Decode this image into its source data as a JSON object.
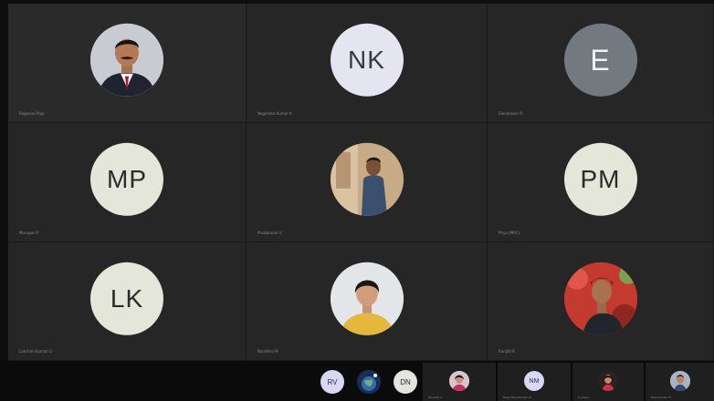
{
  "colors": {
    "tile_bg": "#262626",
    "tile_bg_alt": "#2a2a2a",
    "bottom_bar": "#0b0b0b",
    "initials_avatar_light": "#e4e6da",
    "initials_avatar_lilac": "#e5e5f2",
    "initials_avatar_grey": "#727a7f",
    "mini_avatar": "#d8d8f3"
  },
  "tiles": [
    {
      "name": "Ragavan Raju",
      "initials": "",
      "avatar": "photo-man-suit"
    },
    {
      "name": "Nagendra Kumar K",
      "initials": "NK",
      "avatar": "initials"
    },
    {
      "name": "Elavarasan R",
      "initials": "E",
      "avatar": "initials"
    },
    {
      "name": "Murugan P",
      "initials": "MP",
      "avatar": "initials"
    },
    {
      "name": "Prabakaran V",
      "initials": "",
      "avatar": "photo-man-outdoor"
    },
    {
      "name": "Priya (MPC)",
      "initials": "PM",
      "avatar": "initials"
    },
    {
      "name": "Lakshmi Kumari S",
      "initials": "LK",
      "avatar": "initials"
    },
    {
      "name": "Nandhini M",
      "initials": "",
      "avatar": "photo-woman"
    },
    {
      "name": "Ranjith K",
      "initials": "",
      "avatar": "photo-man-red"
    }
  ],
  "mini_avatars": [
    {
      "initials": "RV",
      "avatar": "initials"
    },
    {
      "initials": "",
      "avatar": "photo-earth"
    },
    {
      "initials": "DN",
      "avatar": "initials"
    }
  ],
  "strip": [
    {
      "name": "Deepika S",
      "initials": "",
      "avatar": "photo-woman-pink"
    },
    {
      "name": "Naga Manikandan M",
      "initials": "NM",
      "avatar": "initials"
    },
    {
      "name": "K Janani",
      "initials": "",
      "avatar": "photo-woman-red"
    },
    {
      "name": "Manikandan M",
      "initials": "",
      "avatar": "photo-person-blue"
    }
  ]
}
